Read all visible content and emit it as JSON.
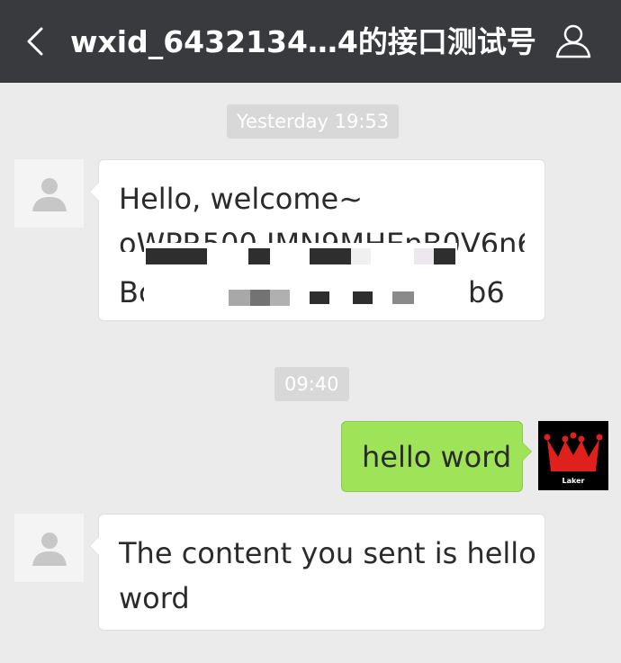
{
  "header": {
    "title": "wxid_6432134…4的接口测试号"
  },
  "timestamps": [
    "Yesterday 19:53",
    "09:40"
  ],
  "messages": [
    {
      "direction": "incoming",
      "lines": [
        "Hello, welcome~",
        "oWPR500 IMN9MHEnB0V6n6",
        "Bc",
        "b6"
      ],
      "redacted": true
    },
    {
      "direction": "outgoing",
      "text": "hello word"
    },
    {
      "direction": "incoming",
      "lines": [
        "The content you sent is hello",
        "word"
      ]
    }
  ],
  "self_avatar": {
    "label": "Laker",
    "colors": {
      "background": "#000000",
      "crown": "#e0201c"
    }
  },
  "colors": {
    "topbar": "#393a3e",
    "background": "#ebebeb",
    "outgoing_bubble": "#9fe358",
    "incoming_bubble": "#ffffff"
  }
}
